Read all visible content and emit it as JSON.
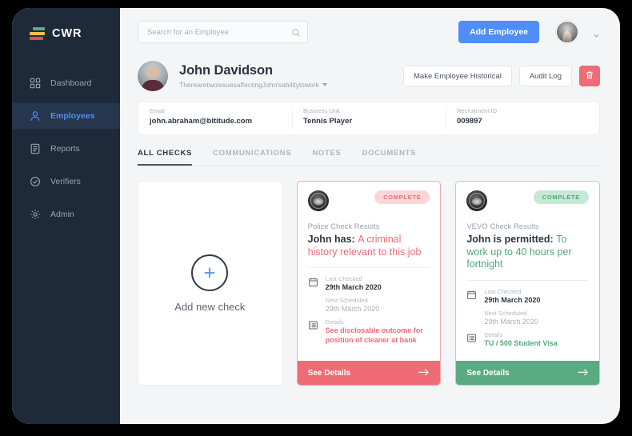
{
  "brand": {
    "name": "CWR",
    "logo_icon": "bars-logo-icon",
    "colors": {
      "bar_green": "#5aab82",
      "bar_yellow": "#f0c14b",
      "bar_red": "#d9534f"
    }
  },
  "sidebar": {
    "items": [
      {
        "label": "Dashboard",
        "icon": "grid-icon",
        "active": false
      },
      {
        "label": "Employees",
        "icon": "user-icon",
        "active": true
      },
      {
        "label": "Reports",
        "icon": "document-icon",
        "active": false
      },
      {
        "label": "Verifiers",
        "icon": "check-circle-icon",
        "active": false
      },
      {
        "label": "Admin",
        "icon": "gear-icon",
        "active": false
      }
    ]
  },
  "topbar": {
    "search_placeholder": "Search for an Employee",
    "search_value": "",
    "search_icon": "search-icon",
    "add_employee_label": "Add Employee",
    "avatar_icon": "user-avatar",
    "caret_icon": "chevron-down-icon"
  },
  "employee": {
    "name": "John Davidson",
    "subtitle": "TherearetwoissuesaffectingJohn'sabilitytowork",
    "subtitle_caret": "caret-down-icon",
    "actions": {
      "historical_label": "Make Employee Historical",
      "audit_log_label": "Audit Log",
      "delete_icon": "trash-icon"
    },
    "info": [
      {
        "label": "Email",
        "value": "john.abraham@bititude.com"
      },
      {
        "label": "Business Unit",
        "value": "Tennis Player"
      },
      {
        "label": "Recruitment ID",
        "value": "009897"
      }
    ]
  },
  "tabs": [
    {
      "label": "ALL CHECKS",
      "active": true
    },
    {
      "label": "COMMUNICATIONS",
      "active": false
    },
    {
      "label": "NOTES",
      "active": false
    },
    {
      "label": "DOCUMENTS",
      "active": false
    }
  ],
  "add_card": {
    "label": "Add new check",
    "icon": "plus-icon"
  },
  "checks": [
    {
      "theme": "red",
      "emblem_icon": "police-emblem-icon",
      "badge": "COMPLETE",
      "kind": "Police Check Results",
      "headline_prefix": "John has:",
      "headline_highlight": "A criminal history relevant to this job",
      "last_checked_label": "Last Checked",
      "last_checked_value": "29th March 2020",
      "next_scheduled_label": "Next Scheduled",
      "next_scheduled_value": "29th March 2020",
      "details_label": "Details",
      "details_value": "See disclosable outcome for position of cleaner at bank",
      "footer_label": "See Details",
      "footer_icon": "arrow-right-icon",
      "calendar_icon": "calendar-icon",
      "list_icon": "list-icon",
      "accent": "#ef6b76"
    },
    {
      "theme": "green",
      "emblem_icon": "vevo-emblem-icon",
      "badge": "COMPLETE",
      "kind": "VEVO Check Results",
      "headline_prefix": "John is permitted:",
      "headline_highlight": "To work up to 40 hours per fortnight",
      "last_checked_label": "Last Checked",
      "last_checked_value": "29th March 2020",
      "next_scheduled_label": "Next Scheduled",
      "next_scheduled_value": "29th March 2020",
      "details_label": "Details",
      "details_value": "TU / 500 Student Visa",
      "footer_label": "See Details",
      "footer_icon": "arrow-right-icon",
      "calendar_icon": "calendar-icon",
      "list_icon": "list-icon",
      "accent": "#5aab82"
    }
  ]
}
